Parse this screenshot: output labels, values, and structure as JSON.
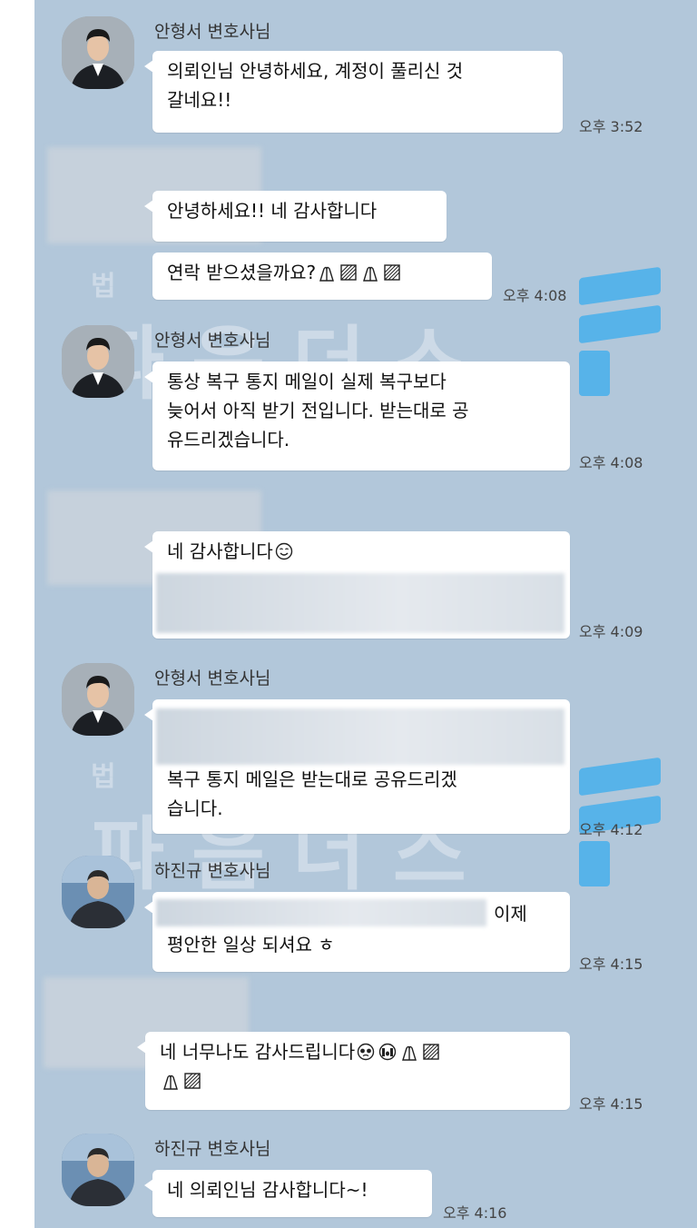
{
  "lawyer1": {
    "name": "안형서 변호사님"
  },
  "lawyer2": {
    "name": "하진규 변호사님"
  },
  "watermark": {
    "small": "법",
    "big": "파음더스"
  },
  "messages": {
    "m1": {
      "lines": [
        "의뢰인님 안녕하세요, 계정이 풀리신 것",
        "갈네요!!"
      ],
      "time": "오후 3:52"
    },
    "m2": {
      "lines": [
        "안녕하세요!! 네 감사합니다"
      ]
    },
    "m3": {
      "text": "연락 받으셨을까요?",
      "time": "오후 4:08"
    },
    "m4": {
      "lines": [
        "통상 복구 통지 메일이 실제 복구보다",
        "늦어서 아직 받기 전입니다. 받는대로 공",
        "유드리겠습니다."
      ],
      "time": "오후 4:08"
    },
    "m5": {
      "text": "네 감사합니다",
      "time": "오후 4:09"
    },
    "m6": {
      "lines": [
        "복구 통지 메일은 받는대로 공유드리겠",
        "습니다."
      ],
      "time": "오후 4:12"
    },
    "m7": {
      "suffix": "이제",
      "line2": "평안한 일상 되셔요 ㅎ",
      "time": "오후 4:15"
    },
    "m8": {
      "text": "네 너무나도 감사드립니다",
      "time": "오후 4:15"
    },
    "m9": {
      "text": "네 의뢰인님 감사합니다~!",
      "time": "오후 4:16"
    }
  },
  "icons": [
    "praying-hands-icon",
    "hatched-square-icon",
    "smile-icon",
    "crying-face-icon",
    "blurred-content"
  ]
}
